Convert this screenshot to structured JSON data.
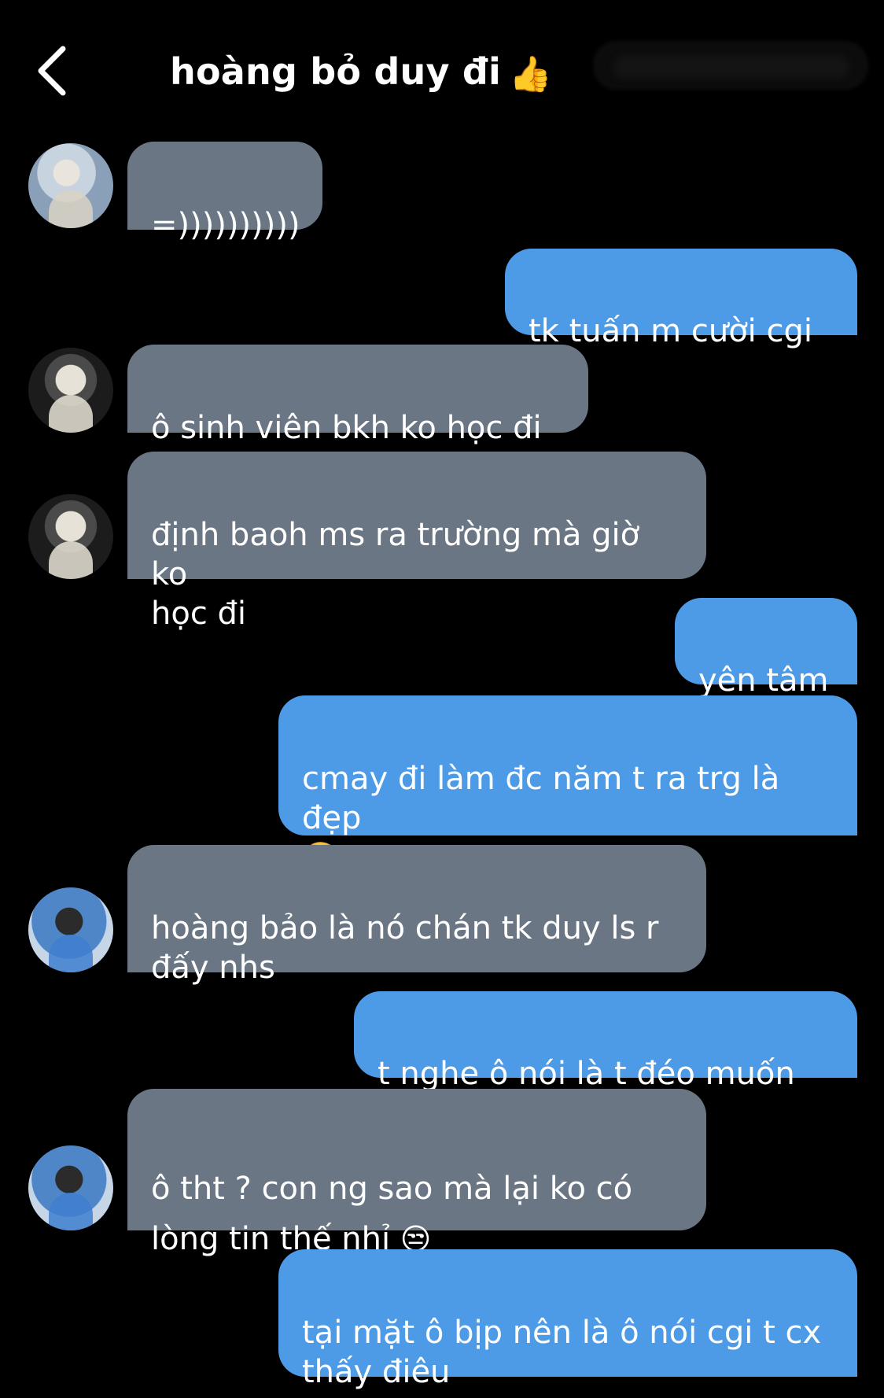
{
  "header": {
    "title": "hoàng bỏ duy đi",
    "title_emoji": "👍"
  },
  "messages": [
    {
      "text": "=))))))))))"
    },
    {
      "text": "tk tuấn m cười cgi ?"
    },
    {
      "text": "ô sinh viên bkh ko học đi à"
    },
    {
      "text": "định baoh ms ra trường mà giờ ko\nhọc đi"
    },
    {
      "text": "yên tâm"
    },
    {
      "text": "cmay đi làm đc năm t ra trg là đẹp\n",
      "emoji": "🤩"
    },
    {
      "text": "hoàng bảo là nó chán tk duy ls r\nđấy nhs"
    },
    {
      "text": "t nghe ô nói là t đéo muốn tin"
    },
    {
      "text": "ô tht ? con ng sao mà lại ko có\nlòng tin thế nhỉ ",
      "emoji": "😒"
    },
    {
      "text": "tại mặt ô bịp nên là ô nói cgi t cx\nthấy điêu"
    }
  ],
  "colors": {
    "background": "#000000",
    "incoming_bubble": "#6b7684",
    "outgoing_bubble": "#4d9be6",
    "text": "#ffffff"
  },
  "icons": {
    "back": "chevron-left-icon"
  }
}
